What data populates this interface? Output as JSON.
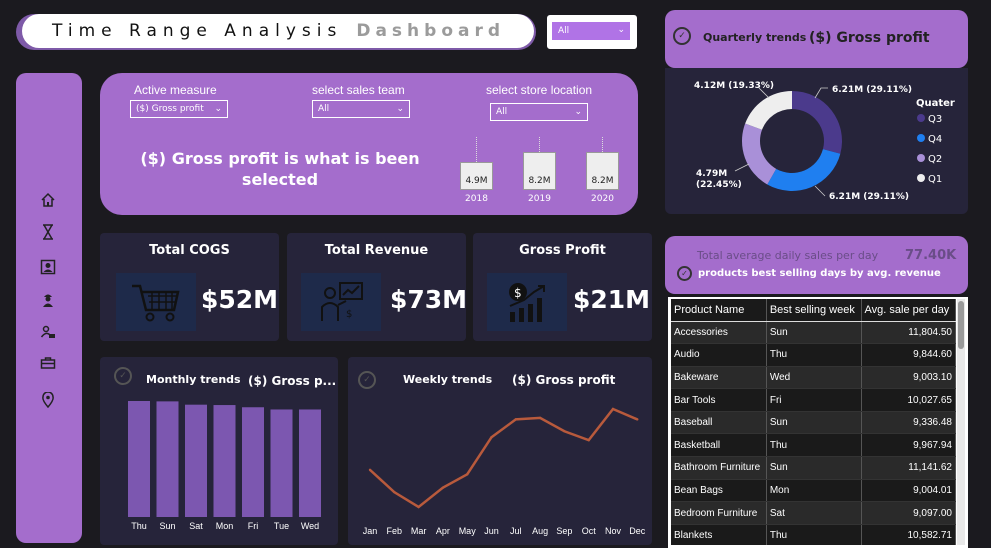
{
  "header": {
    "title_part1": "Time Range Analysis",
    "title_part2": "Dashboard",
    "top_filter_value": "All"
  },
  "filters": {
    "active_measure_label": "Active measure",
    "active_measure_value": "($) Gross profit",
    "sales_team_label": "select sales team",
    "sales_team_value": "All",
    "store_location_label": "select store location",
    "store_location_value": "All",
    "selected_line1": "($) Gross profit is what is been",
    "selected_line2": "selected",
    "yearly": [
      {
        "year": "2018",
        "label": "4.9M",
        "value": 4.9
      },
      {
        "year": "2019",
        "label": "8.2M",
        "value": 8.2
      },
      {
        "year": "2020",
        "label": "8.2M",
        "value": 8.2
      }
    ]
  },
  "nav": {
    "icons": [
      "home-icon",
      "hourglass-icon",
      "profile-card-icon",
      "worker-icon",
      "team-icon",
      "briefcase-icon",
      "location-pin-icon"
    ]
  },
  "kpis": {
    "cogs_title": "Total COGS",
    "cogs_value": "$52M",
    "revenue_title": "Total Revenue",
    "revenue_value": "$73M",
    "profit_title": "Gross Profit",
    "profit_value": "$21M"
  },
  "monthly": {
    "title": "Monthly trends",
    "measure": "($) Gross p..."
  },
  "weekly": {
    "title": "Weekly trends",
    "measure": "($) Gross profit"
  },
  "quarterly": {
    "title": "Quarterly trends",
    "measure": "($) Gross profit",
    "legend_title": "Quater"
  },
  "avg": {
    "title": "Total average daily sales per day",
    "value": "77.40K",
    "subtitle": "products best selling days by avg. revenue"
  },
  "table": {
    "headers": [
      "Product Name",
      "Best selling week",
      "Avg. sale per day"
    ],
    "rows": [
      [
        "Accessories",
        "Sun",
        "11,804.50"
      ],
      [
        "Audio",
        "Thu",
        "9,844.60"
      ],
      [
        "Bakeware",
        "Wed",
        "9,003.10"
      ],
      [
        "Bar Tools",
        "Fri",
        "10,027.65"
      ],
      [
        "Baseball",
        "Sun",
        "9,336.48"
      ],
      [
        "Basketball",
        "Thu",
        "9,967.94"
      ],
      [
        "Bathroom Furniture",
        "Sun",
        "11,141.62"
      ],
      [
        "Bean Bags",
        "Mon",
        "9,004.01"
      ],
      [
        "Bedroom Furniture",
        "Sat",
        "9,097.00"
      ],
      [
        "Blankets",
        "Thu",
        "10,582.71"
      ]
    ]
  },
  "colors": {
    "panel_purple": "#a46dcc",
    "panel_navy": "#26243a",
    "bar_purple": "#7c57b0",
    "line_orange": "#b85a3c",
    "q3": "#4b3a8c",
    "q4": "#1f7ff0",
    "q2": "#a990d8",
    "q1": "#eeeeee"
  },
  "chart_data": [
    {
      "type": "bar",
      "categories": [
        "Thu",
        "Sun",
        "Sat",
        "Mon",
        "Fri",
        "Tue",
        "Wed"
      ],
      "values": [
        3.15,
        3.14,
        3.05,
        3.04,
        2.98,
        2.92,
        2.92
      ],
      "title": "Monthly trends"
    },
    {
      "type": "line",
      "categories": [
        "Jan",
        "Feb",
        "Mar",
        "Apr",
        "May",
        "Jun",
        "Jul",
        "Aug",
        "Sep",
        "Oct",
        "Nov",
        "Dec"
      ],
      "values": [
        1.7,
        1.55,
        1.45,
        1.58,
        1.67,
        1.92,
        2.04,
        2.05,
        1.96,
        1.9,
        2.11,
        2.04
      ],
      "title": "Weekly trends"
    },
    {
      "type": "pie",
      "categories": [
        "Q3",
        "Q4",
        "Q2",
        "Q1"
      ],
      "values": [
        6.21,
        6.21,
        4.79,
        4.12
      ],
      "labels": [
        "6.21M (29.11%)",
        "6.21M (29.11%)",
        "4.79M (22.45%)",
        "4.12M (19.33%)"
      ],
      "percents": [
        29.11,
        29.11,
        22.45,
        19.33
      ],
      "legend_title": "Quater"
    }
  ]
}
